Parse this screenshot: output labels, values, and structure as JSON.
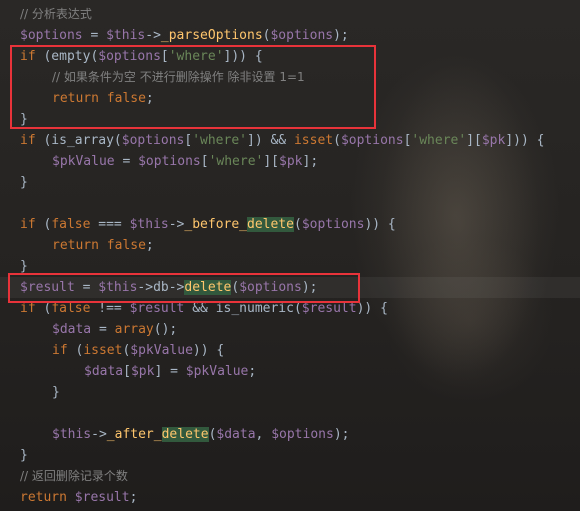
{
  "colors": {
    "background": "#252321",
    "keyword": "#cc7832",
    "variable": "#9876aa",
    "string": "#6a8759",
    "comment": "#808080",
    "function": "#ffc66d",
    "plain": "#a9b7c6",
    "usage_highlight": "#32593d",
    "annotation_box": "#e8333a"
  },
  "annotations": [
    "red-rectangle-empty-where-check",
    "red-rectangle-db-delete-call"
  ],
  "lines": [
    {
      "indent": 0,
      "tokens": [
        {
          "t": "comment",
          "v": "// 分析表达式"
        }
      ]
    },
    {
      "indent": 0,
      "tokens": [
        {
          "t": "variable",
          "v": "$options"
        },
        {
          "t": "plain",
          "v": " = "
        },
        {
          "t": "variable",
          "v": "$this"
        },
        {
          "t": "plain",
          "v": "->"
        },
        {
          "t": "function",
          "v": "_parseOptions"
        },
        {
          "t": "punct",
          "v": "("
        },
        {
          "t": "variable",
          "v": "$options"
        },
        {
          "t": "punct",
          "v": ");"
        }
      ]
    },
    {
      "indent": 0,
      "tokens": [
        {
          "t": "keyword",
          "v": "if"
        },
        {
          "t": "plain",
          "v": " (empty("
        },
        {
          "t": "variable",
          "v": "$options"
        },
        {
          "t": "punct",
          "v": "["
        },
        {
          "t": "string",
          "v": "'where'"
        },
        {
          "t": "punct",
          "v": "])) {"
        }
      ]
    },
    {
      "indent": 1,
      "tokens": [
        {
          "t": "comment",
          "v": "// 如果条件为空 不进行删除操作 除非设置 1=1"
        }
      ]
    },
    {
      "indent": 1,
      "tokens": [
        {
          "t": "keyword",
          "v": "return false"
        },
        {
          "t": "punct",
          "v": ";"
        }
      ]
    },
    {
      "indent": 0,
      "tokens": [
        {
          "t": "punct",
          "v": "}"
        }
      ]
    },
    {
      "indent": 0,
      "tokens": [
        {
          "t": "keyword",
          "v": "if"
        },
        {
          "t": "plain",
          "v": " (is_array("
        },
        {
          "t": "variable",
          "v": "$options"
        },
        {
          "t": "punct",
          "v": "["
        },
        {
          "t": "string",
          "v": "'where'"
        },
        {
          "t": "punct",
          "v": "]) && "
        },
        {
          "t": "keyword",
          "v": "isset"
        },
        {
          "t": "punct",
          "v": "("
        },
        {
          "t": "variable",
          "v": "$options"
        },
        {
          "t": "punct",
          "v": "["
        },
        {
          "t": "string",
          "v": "'where'"
        },
        {
          "t": "punct",
          "v": "]["
        },
        {
          "t": "variable",
          "v": "$pk"
        },
        {
          "t": "punct",
          "v": "])) {"
        }
      ]
    },
    {
      "indent": 1,
      "tokens": [
        {
          "t": "variable",
          "v": "$pkValue"
        },
        {
          "t": "plain",
          "v": " = "
        },
        {
          "t": "variable",
          "v": "$options"
        },
        {
          "t": "punct",
          "v": "["
        },
        {
          "t": "string",
          "v": "'where'"
        },
        {
          "t": "punct",
          "v": "]["
        },
        {
          "t": "variable",
          "v": "$pk"
        },
        {
          "t": "punct",
          "v": "];"
        }
      ]
    },
    {
      "indent": 0,
      "tokens": [
        {
          "t": "punct",
          "v": "}"
        }
      ]
    },
    {
      "indent": 0,
      "tokens": []
    },
    {
      "indent": 0,
      "tokens": [
        {
          "t": "keyword",
          "v": "if"
        },
        {
          "t": "plain",
          "v": " ("
        },
        {
          "t": "keyword",
          "v": "false"
        },
        {
          "t": "plain",
          "v": " === "
        },
        {
          "t": "variable",
          "v": "$this"
        },
        {
          "t": "plain",
          "v": "->"
        },
        {
          "t": "function",
          "v": "_before_"
        },
        {
          "t": "highlight",
          "v": "delete"
        },
        {
          "t": "punct",
          "v": "("
        },
        {
          "t": "variable",
          "v": "$options"
        },
        {
          "t": "punct",
          "v": ")) {"
        }
      ]
    },
    {
      "indent": 1,
      "tokens": [
        {
          "t": "keyword",
          "v": "return false"
        },
        {
          "t": "punct",
          "v": ";"
        }
      ]
    },
    {
      "indent": 0,
      "tokens": [
        {
          "t": "punct",
          "v": "}"
        }
      ]
    },
    {
      "indent": 0,
      "current": true,
      "tokens": [
        {
          "t": "variable",
          "v": "$result"
        },
        {
          "t": "plain",
          "v": " = "
        },
        {
          "t": "variable",
          "v": "$this"
        },
        {
          "t": "plain",
          "v": "->db->"
        },
        {
          "t": "highlight",
          "v": "delete"
        },
        {
          "t": "punct",
          "v": "("
        },
        {
          "t": "variable",
          "v": "$options"
        },
        {
          "t": "punct",
          "v": ");"
        }
      ]
    },
    {
      "indent": 0,
      "tokens": [
        {
          "t": "keyword",
          "v": "if"
        },
        {
          "t": "plain",
          "v": " ("
        },
        {
          "t": "keyword",
          "v": "false"
        },
        {
          "t": "plain",
          "v": " !== "
        },
        {
          "t": "variable",
          "v": "$result"
        },
        {
          "t": "plain",
          "v": " && is_numeric("
        },
        {
          "t": "variable",
          "v": "$result"
        },
        {
          "t": "punct",
          "v": ")) {"
        }
      ]
    },
    {
      "indent": 1,
      "tokens": [
        {
          "t": "variable",
          "v": "$data"
        },
        {
          "t": "plain",
          "v": " = "
        },
        {
          "t": "keyword",
          "v": "array"
        },
        {
          "t": "punct",
          "v": "();"
        }
      ]
    },
    {
      "indent": 1,
      "tokens": [
        {
          "t": "keyword",
          "v": "if"
        },
        {
          "t": "plain",
          "v": " ("
        },
        {
          "t": "keyword",
          "v": "isset"
        },
        {
          "t": "punct",
          "v": "("
        },
        {
          "t": "variable",
          "v": "$pkValue"
        },
        {
          "t": "punct",
          "v": ")) {"
        }
      ]
    },
    {
      "indent": 2,
      "tokens": [
        {
          "t": "variable",
          "v": "$data"
        },
        {
          "t": "punct",
          "v": "["
        },
        {
          "t": "variable",
          "v": "$pk"
        },
        {
          "t": "punct",
          "v": "] = "
        },
        {
          "t": "variable",
          "v": "$pkValue"
        },
        {
          "t": "punct",
          "v": ";"
        }
      ]
    },
    {
      "indent": 1,
      "tokens": [
        {
          "t": "punct",
          "v": "}"
        }
      ]
    },
    {
      "indent": 0,
      "tokens": []
    },
    {
      "indent": 1,
      "tokens": [
        {
          "t": "variable",
          "v": "$this"
        },
        {
          "t": "plain",
          "v": "->"
        },
        {
          "t": "function",
          "v": "_after_"
        },
        {
          "t": "highlight",
          "v": "delete"
        },
        {
          "t": "punct",
          "v": "("
        },
        {
          "t": "variable",
          "v": "$data"
        },
        {
          "t": "punct",
          "v": ", "
        },
        {
          "t": "variable",
          "v": "$options"
        },
        {
          "t": "punct",
          "v": ");"
        }
      ]
    },
    {
      "indent": 0,
      "tokens": [
        {
          "t": "punct",
          "v": "}"
        }
      ]
    },
    {
      "indent": 0,
      "tokens": [
        {
          "t": "comment",
          "v": "// 返回删除记录个数"
        }
      ]
    },
    {
      "indent": 0,
      "tokens": [
        {
          "t": "keyword",
          "v": "return"
        },
        {
          "t": "plain",
          "v": " "
        },
        {
          "t": "variable",
          "v": "$result"
        },
        {
          "t": "punct",
          "v": ";"
        }
      ]
    }
  ]
}
